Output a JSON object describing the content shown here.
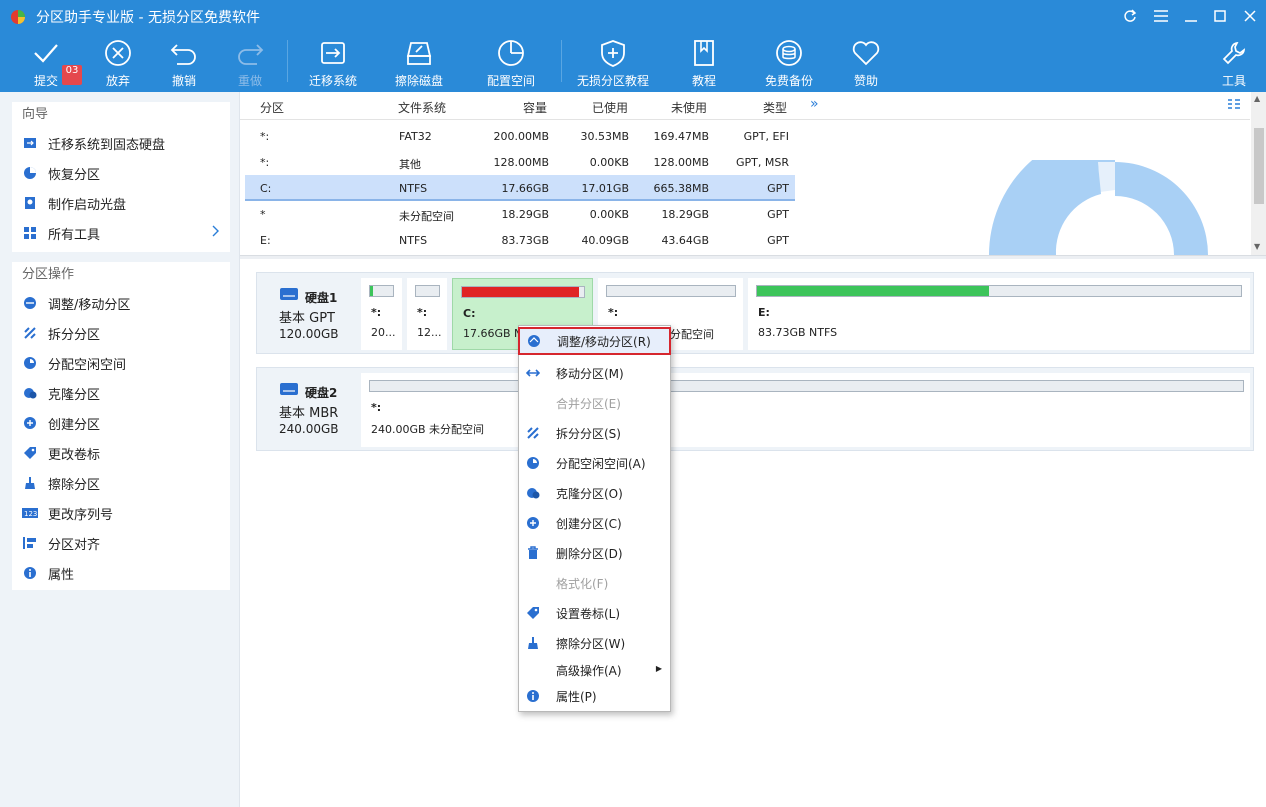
{
  "app": {
    "title": "分区助手专业版 - 无损分区免费软件"
  },
  "toolbar": {
    "badge": "03",
    "buttons": [
      {
        "label": "提交",
        "icon": "check-icon"
      },
      {
        "label": "放弃",
        "icon": "discard-icon"
      },
      {
        "label": "撤销",
        "icon": "undo-icon"
      },
      {
        "label": "重做",
        "icon": "redo-icon"
      },
      {
        "label": "迁移系统",
        "icon": "migrate-os-icon"
      },
      {
        "label": "擦除磁盘",
        "icon": "wipe-disk-icon"
      },
      {
        "label": "配置空间",
        "icon": "allocate-space-icon"
      },
      {
        "label": "无损分区教程",
        "icon": "shield-icon"
      },
      {
        "label": "教程",
        "icon": "book-icon"
      },
      {
        "label": "免费备份",
        "icon": "backup-icon"
      },
      {
        "label": "赞助",
        "icon": "heart-icon"
      },
      {
        "label": "工具",
        "icon": "wrench-icon"
      }
    ]
  },
  "sidebar": {
    "wizard_title": "向导",
    "wizard_items": [
      {
        "label": "迁移系统到固态硬盘",
        "icon": "migrate-icon"
      },
      {
        "label": "恢复分区",
        "icon": "recover-icon"
      },
      {
        "label": "制作启动光盘",
        "icon": "bootable-disc-icon"
      },
      {
        "label": "所有工具",
        "icon": "grid-icon"
      }
    ],
    "ops_title": "分区操作",
    "ops_items": [
      {
        "label": "调整/移动分区",
        "icon": "resize-icon"
      },
      {
        "label": "拆分分区",
        "icon": "split-icon"
      },
      {
        "label": "分配空闲空间",
        "icon": "allocate-icon"
      },
      {
        "label": "克隆分区",
        "icon": "clone-icon"
      },
      {
        "label": "创建分区",
        "icon": "create-icon"
      },
      {
        "label": "更改卷标",
        "icon": "label-icon"
      },
      {
        "label": "擦除分区",
        "icon": "wipe-icon"
      },
      {
        "label": "更改序列号",
        "icon": "serial-icon"
      },
      {
        "label": "分区对齐",
        "icon": "align-icon"
      },
      {
        "label": "属性",
        "icon": "info-icon"
      }
    ]
  },
  "table": {
    "headers": [
      "分区",
      "文件系统",
      "容量",
      "已使用",
      "未使用",
      "类型"
    ],
    "more": "»",
    "rows": [
      {
        "name": "*:",
        "fs": "FAT32",
        "cap": "200.00MB",
        "used": "30.53MB",
        "free": "169.47MB",
        "type": "GPT, EFI"
      },
      {
        "name": "*:",
        "fs": "其他",
        "cap": "128.00MB",
        "used": "0.00KB",
        "free": "128.00MB",
        "type": "GPT, MSR"
      },
      {
        "name": "C:",
        "fs": "NTFS",
        "cap": "17.66GB",
        "used": "17.01GB",
        "free": "665.38MB",
        "type": "GPT"
      },
      {
        "name": "*",
        "fs": "未分配空间",
        "cap": "18.29GB",
        "used": "0.00KB",
        "free": "18.29GB",
        "type": "GPT"
      },
      {
        "name": "E:",
        "fs": "NTFS",
        "cap": "83.73GB",
        "used": "40.09GB",
        "free": "43.64GB",
        "type": "GPT"
      }
    ]
  },
  "disks": [
    {
      "name": "硬盘1",
      "type": "基本 GPT",
      "size": "120.00GB",
      "partitions": [
        {
          "label": "*:",
          "info": "20...",
          "used_fraction": 0.15,
          "bar_color": "#3cc45a"
        },
        {
          "label": "*:",
          "info": "12...",
          "used_fraction": 0.0,
          "bar_color": "#3cc45a"
        },
        {
          "label": "C:",
          "info": "17.66GB NTFS",
          "used_fraction": 0.96,
          "bar_color": "#e02424"
        },
        {
          "label": "*:",
          "info": "18.29GB 未分配空间",
          "used_fraction": 0.0,
          "bar_color": "#3cc45a"
        },
        {
          "label": "E:",
          "info": "83.73GB NTFS",
          "used_fraction": 0.48,
          "bar_color": "#3cc45a"
        }
      ]
    },
    {
      "name": "硬盘2",
      "type": "基本 MBR",
      "size": "240.00GB",
      "partitions": [
        {
          "label": "*:",
          "info": "240.00GB 未分配空间",
          "used_fraction": 0.0,
          "bar_color": "#3cc45a"
        }
      ]
    }
  ],
  "context_menu": {
    "items": [
      {
        "label": "调整/移动分区(R)",
        "icon": "resize-icon",
        "state": "highlighted"
      },
      {
        "label": "移动分区(M)",
        "icon": "move-icon",
        "state": "normal"
      },
      {
        "label": "合并分区(E)",
        "icon": "",
        "state": "disabled"
      },
      {
        "label": "拆分分区(S)",
        "icon": "split-icon",
        "state": "normal"
      },
      {
        "label": "分配空闲空间(A)",
        "icon": "allocate-icon",
        "state": "normal"
      },
      {
        "label": "克隆分区(O)",
        "icon": "clone-icon",
        "state": "normal"
      },
      {
        "label": "创建分区(C)",
        "icon": "create-icon",
        "state": "normal"
      },
      {
        "label": "删除分区(D)",
        "icon": "delete-icon",
        "state": "normal"
      },
      {
        "label": "格式化(F)",
        "icon": "",
        "state": "disabled"
      },
      {
        "label": "设置卷标(L)",
        "icon": "label-icon",
        "state": "normal"
      },
      {
        "label": "擦除分区(W)",
        "icon": "wipe-icon",
        "state": "normal"
      },
      {
        "label": "高级操作(A)",
        "icon": "",
        "state": "submenu"
      },
      {
        "label": "属性(P)",
        "icon": "info-icon",
        "state": "normal"
      }
    ]
  },
  "colors": {
    "brand": "#2a8ad8",
    "selected_partition": "#c7f0cc",
    "highlight_border": "#d6262e",
    "accent_icon": "#2a6fd0"
  }
}
